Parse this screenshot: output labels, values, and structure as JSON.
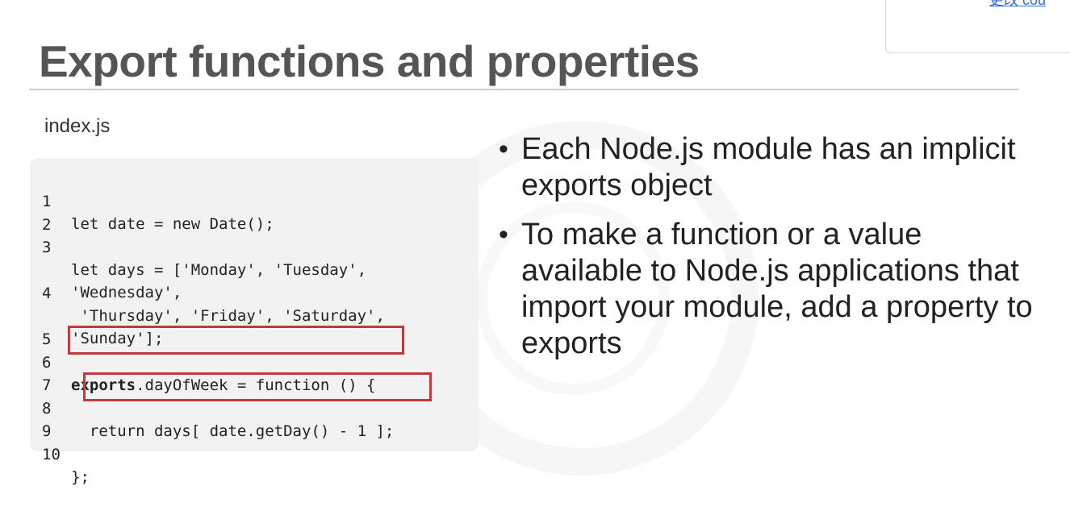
{
  "top_right_link": "更改 cou",
  "title": "Export functions and properties",
  "file_name": "index.js",
  "code_lines": [
    {
      "num": "1",
      "text": "let date = new Date();"
    },
    {
      "num": "2",
      "text": ""
    },
    {
      "num": "3",
      "text": "let days = ['Monday', 'Tuesday',"
    },
    {
      "num": "",
      "text": "'Wednesday',"
    },
    {
      "num": "4",
      "text": " 'Thursday', 'Friday', 'Saturday',"
    },
    {
      "num": "",
      "text": "'Sunday'];"
    },
    {
      "num": "5",
      "text": ""
    },
    {
      "num": "6",
      "text_bold": "exports",
      "text_rest": ".dayOfWeek = function () {"
    },
    {
      "num": "7",
      "text": ""
    },
    {
      "num": "8",
      "text": "  return days[ date.getDay() - 1 ];"
    },
    {
      "num": "9",
      "text": ""
    },
    {
      "num": "10",
      "text": "};"
    }
  ],
  "bullets": [
    "Each Node.js module has an implicit exports object",
    "To make a function or a value available to Node.js applications that import your module, add a property to exports"
  ],
  "bullet_symbol": "•",
  "highlight_color": "#c0393b"
}
